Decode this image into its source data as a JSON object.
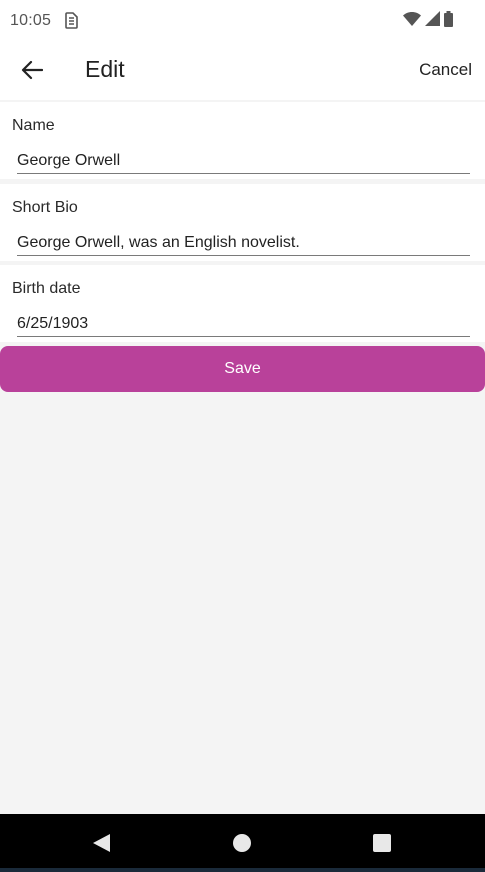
{
  "status_bar": {
    "time": "10:05",
    "icons": [
      "sim-icon",
      "wifi-icon",
      "signal-icon",
      "battery-icon"
    ]
  },
  "app_bar": {
    "title": "Edit",
    "back_icon": "arrow-back-icon",
    "cancel_label": "Cancel"
  },
  "form": {
    "name": {
      "label": "Name",
      "value": "George Orwell"
    },
    "short_bio": {
      "label": "Short Bio",
      "value": "George Orwell, was an English novelist."
    },
    "birth_date": {
      "label": "Birth date",
      "value": "6/25/1903"
    },
    "save_label": "Save"
  },
  "nav_bar": {
    "icons": [
      "nav-back-icon",
      "nav-home-icon",
      "nav-recents-icon"
    ]
  },
  "colors": {
    "accent": "#b9419a",
    "background": "#f4f4f4",
    "surface": "#ffffff",
    "nav_bar": "#000000"
  }
}
